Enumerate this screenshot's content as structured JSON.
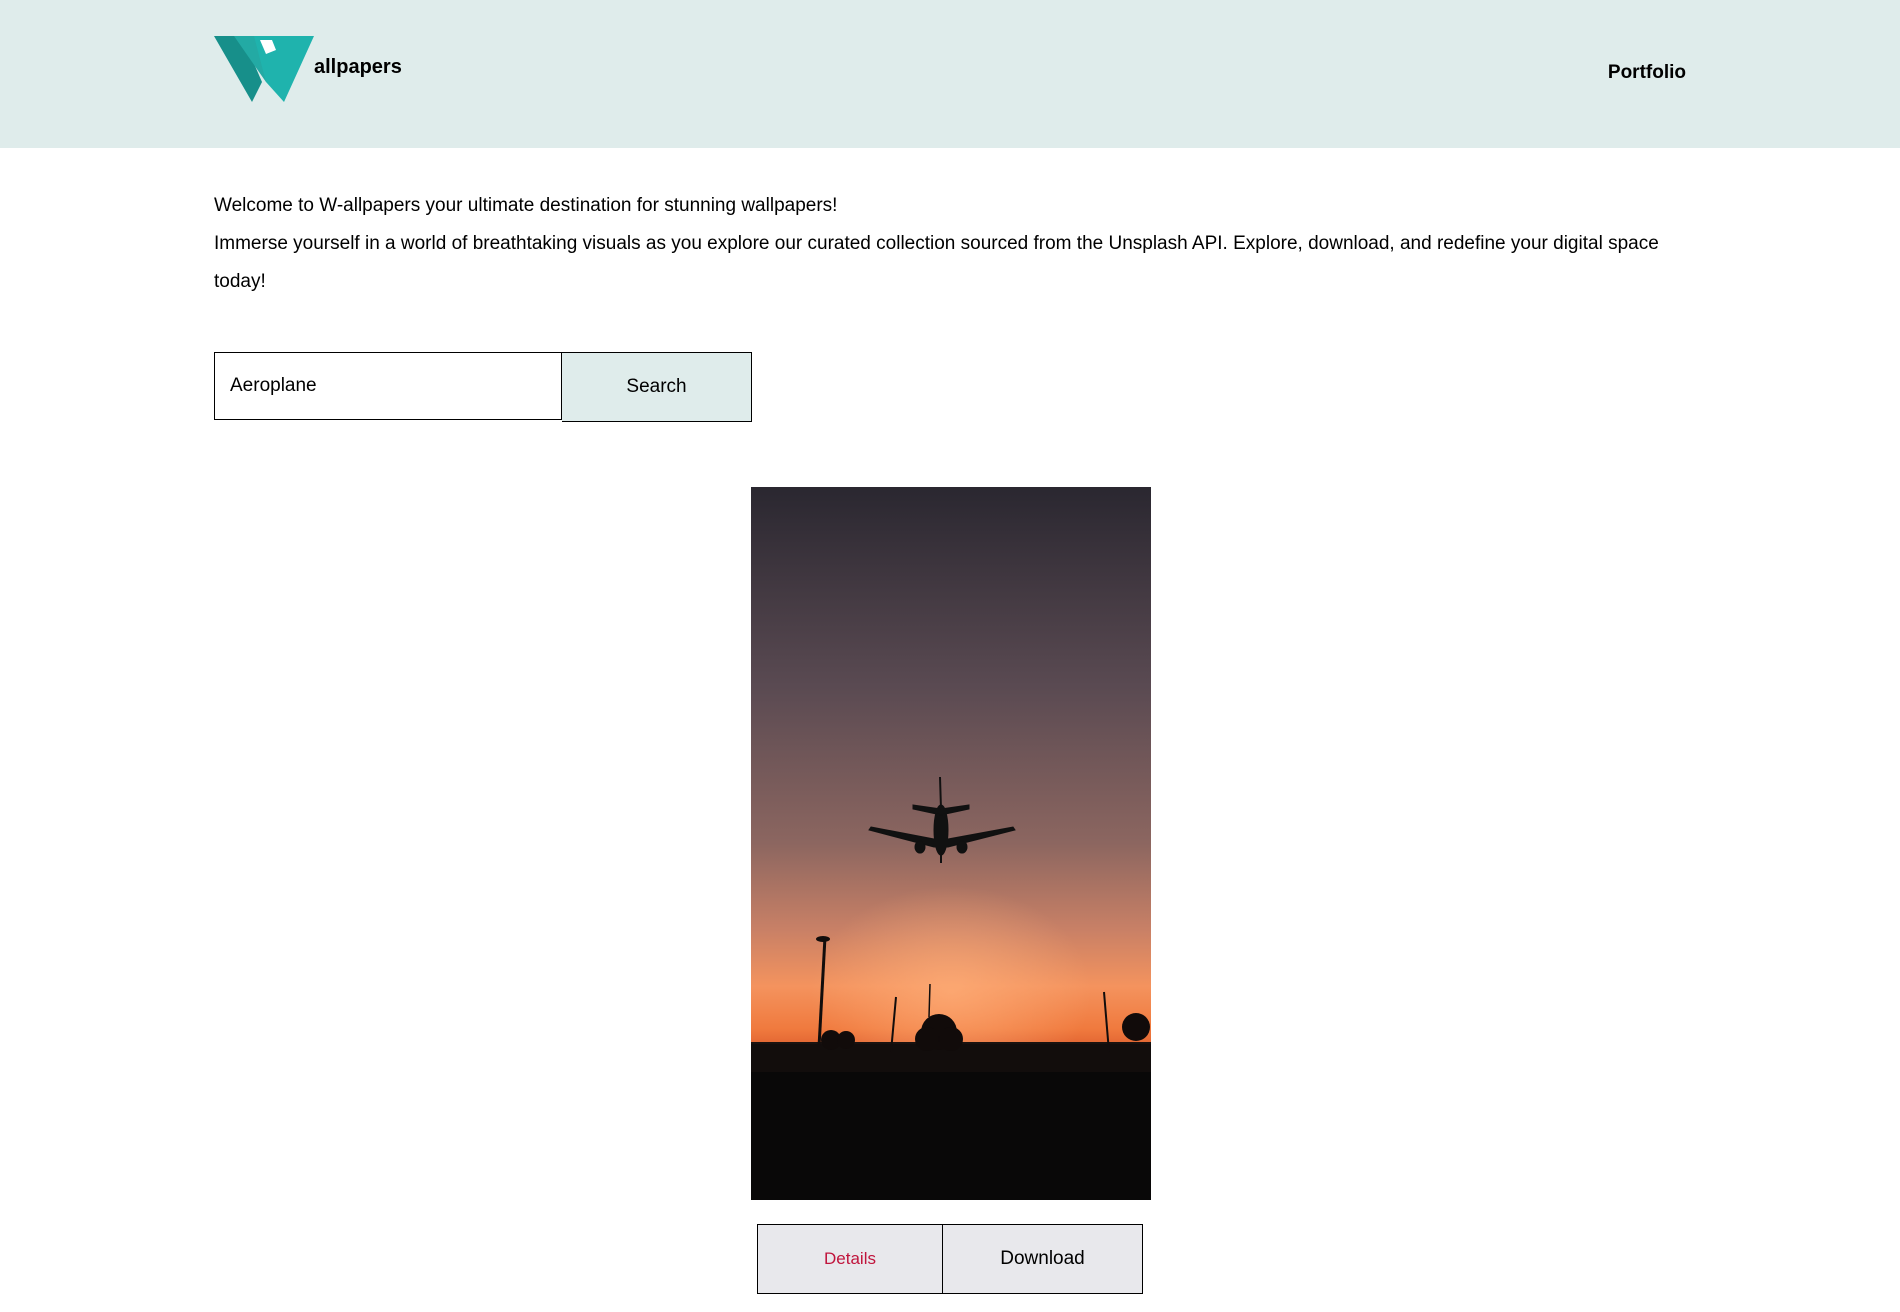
{
  "header": {
    "logo_text": "allpapers",
    "logo_icon": "w-logo-icon",
    "nav": {
      "portfolio_label": "Portfolio"
    },
    "background_color": "#dfeceb"
  },
  "intro": {
    "line1": "Welcome to W-allpapers your ultimate destination for stunning wallpapers!",
    "line2": "Immerse yourself in a world of breathtaking visuals as you explore our curated collection sourced from the Unsplash API. Explore, download, and redefine your digital space today!"
  },
  "search": {
    "value": "Aeroplane",
    "button_label": "Search"
  },
  "results": [
    {
      "image_subject": "airplane silhouette at sunset",
      "details_label": "Details",
      "download_label": "Download"
    }
  ],
  "colors": {
    "accent": "#dfeceb",
    "details_text": "#c0143c",
    "logo_teal": "#1fb3ad"
  }
}
